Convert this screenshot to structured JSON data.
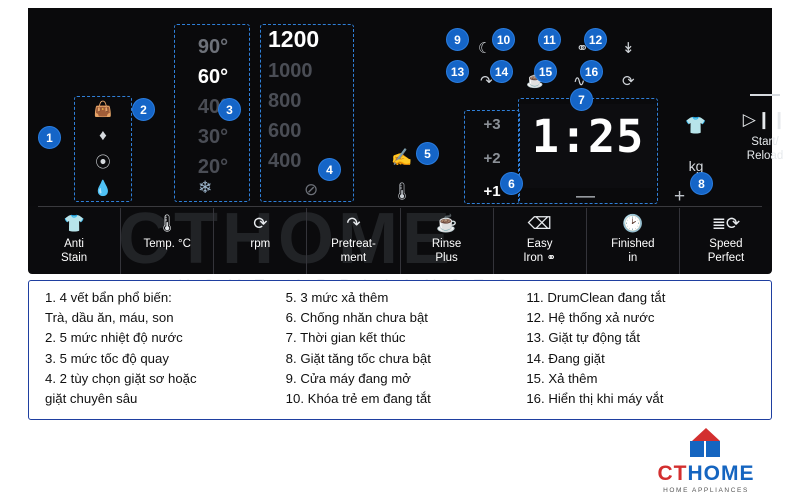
{
  "panel": {
    "soil_icons": [
      "bag-icon",
      "droplet-icon",
      "spray-icon",
      "bottle-icon"
    ],
    "temperatures": [
      "90°",
      "60°",
      "40°",
      "30°",
      "20°"
    ],
    "temperature_selected": "60°",
    "cold_icon": "snowflake-icon",
    "spin_speeds": [
      "1200",
      "1000",
      "800",
      "600",
      "400"
    ],
    "spin_selected": "1200",
    "spin_off_icon": "no-spin-icon",
    "pretreat_icons": [
      "hand-wash-icon",
      "thermometer-icon"
    ],
    "rinse_levels": [
      "+3",
      "+2",
      "+1"
    ],
    "rinse_selected": "+1",
    "display_value": "1:25",
    "minus_label": "—",
    "plus_label": "+",
    "load_icon": "tshirt-icon",
    "load_unit": "kg",
    "start": {
      "bar": "",
      "play_pause_icon": "▷❙❙",
      "label": "Start/\nReload"
    },
    "status_icons_row1": [
      "door-open-icon",
      "child-lock-icon",
      "drum-clean-icon",
      "water-drain-icon"
    ],
    "status_icons_row2": [
      "auto-wash-icon",
      "washing-icon",
      "rinse-plus-icon",
      "spin-display-icon"
    ]
  },
  "buttons": [
    {
      "icon": "tshirt-stain-icon",
      "label": "Anti\nStain"
    },
    {
      "icon": "thermometer-icon",
      "label": "Temp. °C"
    },
    {
      "icon": "spin-icon",
      "label": "rpm"
    },
    {
      "icon": "pretreat-icon",
      "label": "Pretreat-\nment"
    },
    {
      "icon": "rinse-icon",
      "label": "Rinse\nPlus"
    },
    {
      "icon": "iron-icon",
      "label": "Easy\nIron"
    },
    {
      "icon": "clock-icon",
      "label": "Finished\nin"
    },
    {
      "icon": "speed-icon",
      "label": "Speed\nPerfect"
    }
  ],
  "callouts": [
    {
      "n": "1"
    },
    {
      "n": "2"
    },
    {
      "n": "3"
    },
    {
      "n": "4"
    },
    {
      "n": "5"
    },
    {
      "n": "6"
    },
    {
      "n": "7"
    },
    {
      "n": "8"
    },
    {
      "n": "9"
    },
    {
      "n": "10"
    },
    {
      "n": "11"
    },
    {
      "n": "12"
    },
    {
      "n": "13"
    },
    {
      "n": "14"
    },
    {
      "n": "15"
    },
    {
      "n": "16"
    }
  ],
  "legend": {
    "column1": [
      "1. 4 vết bẩn phổ biến:",
      "Trà, dầu ăn, máu, son",
      "2. 5 mức nhiệt độ nước",
      "3. 5 mức tốc độ quay",
      "4. 2 tùy chọn giặt sơ hoặc",
      "giặt chuyên sâu"
    ],
    "column2": [
      "5. 3 mức xả thêm",
      "6. Chống nhăn chưa bật",
      "7. Thời gian kết thúc",
      "8. Giặt tăng tốc chưa bật",
      "9. Cửa máy đang mở",
      "10. Khóa trẻ em đang tắt"
    ],
    "column3": [
      "11. DrumClean đang tắt",
      "12. Hệ thống xả nước",
      "13. Giặt tự động tắt",
      "14. Đang giặt",
      "15. Xả thêm",
      "16. Hiển thị khi máy vắt"
    ]
  },
  "watermark": {
    "main": "CTHOME",
    "sub": "HOME APPLIANCES"
  },
  "logo": {
    "name_ct": "CT",
    "name_home": "HOME",
    "sub": "HOME APPLIANCES"
  },
  "colors": {
    "accent_blue": "#1565c7",
    "panel_black": "#0b0b0d",
    "legend_border": "#1f3fa0"
  }
}
